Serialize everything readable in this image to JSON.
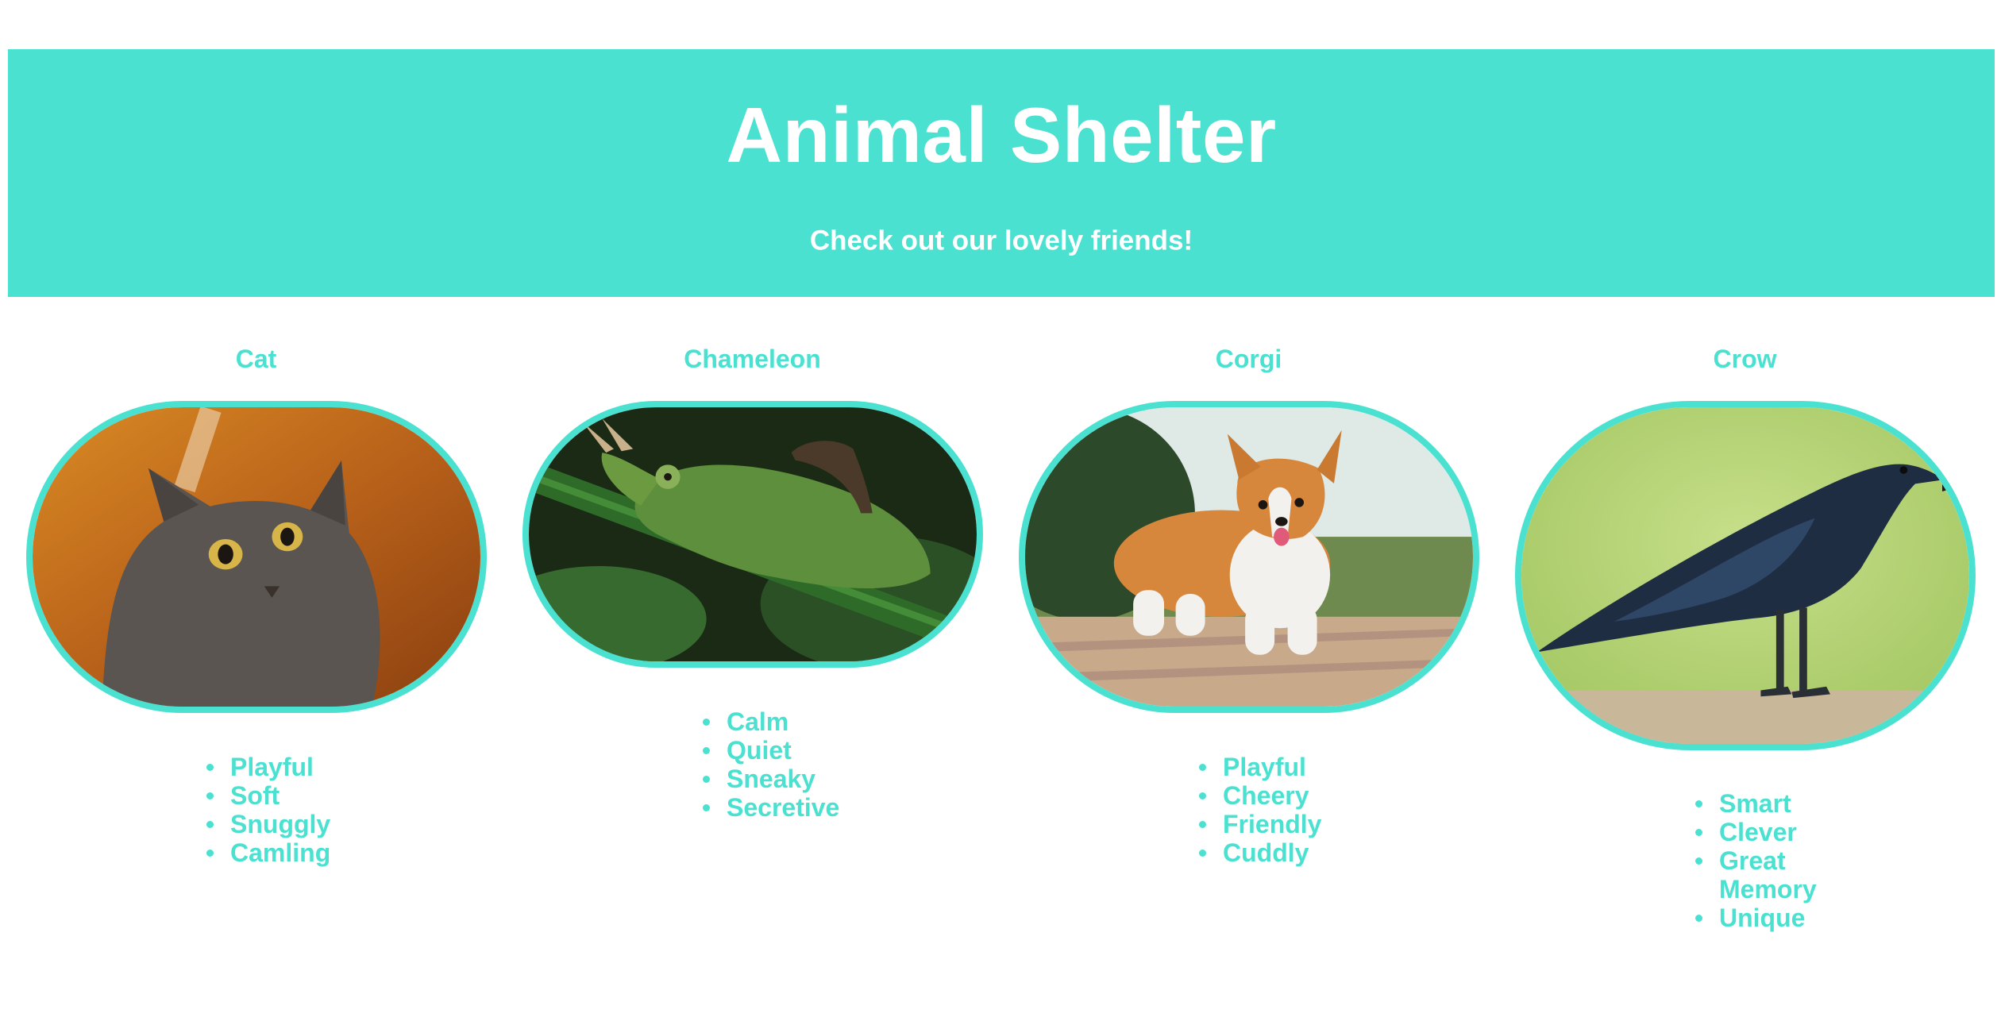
{
  "header": {
    "title": "Animal Shelter",
    "subtitle": "Check out our lovely friends!"
  },
  "colors": {
    "accent": "#4ae1d1",
    "text_on_accent": "#ffffff"
  },
  "animals": [
    {
      "name": "Cat",
      "traits": [
        "Playful",
        "Soft",
        "Snuggly",
        "Camling"
      ]
    },
    {
      "name": "Chameleon",
      "traits": [
        "Calm",
        "Quiet",
        "Sneaky",
        "Secretive"
      ]
    },
    {
      "name": "Corgi",
      "traits": [
        "Playful",
        "Cheery",
        "Friendly",
        "Cuddly"
      ]
    },
    {
      "name": "Crow",
      "traits": [
        "Smart",
        "Clever",
        "Great Memory",
        "Unique"
      ]
    }
  ]
}
